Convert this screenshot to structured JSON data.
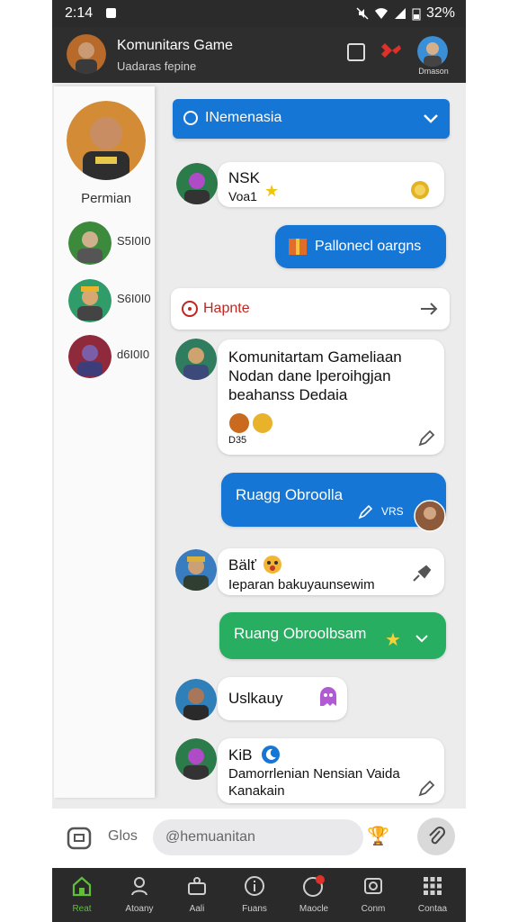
{
  "status": {
    "time": "2:14",
    "battery": "32%"
  },
  "header": {
    "title": "Komunitars Game",
    "subtitle": "Uadaras fepine",
    "user_label": "Dmason"
  },
  "sidebar": {
    "name": "Permian",
    "items": [
      {
        "value": "S5I0I0"
      },
      {
        "value": "S6I0I0"
      },
      {
        "value": "d6I0I0"
      }
    ]
  },
  "select": {
    "label": "INemenasia"
  },
  "messages": {
    "m1": {
      "name": "NSK",
      "sub": "Voa1"
    },
    "m2": {
      "text": "Pallonecl oargns"
    },
    "hap": {
      "label": "Hapnte"
    },
    "m3": {
      "text": "Komunitartam Gameliaan Nodan dane lperoihgjan beahanss Dedaia",
      "meta": "D35"
    },
    "m4": {
      "text": "Ruagg Obroolla",
      "tag": "VRS"
    },
    "m5": {
      "name": "Bälť",
      "text": "Ieparan bakuyaunsewim"
    },
    "m6": {
      "text": "Ruang Obroolbsam"
    },
    "m7": {
      "name": "Uslkauy"
    },
    "m8": {
      "name": "KiB",
      "text": "Damorrlenian Nensian Vaida Kanakain"
    }
  },
  "composer": {
    "label": "Glos",
    "placeholder": "@hemuanitan"
  },
  "nav": [
    {
      "label": "Reat",
      "icon": "home-icon"
    },
    {
      "label": "Atoany",
      "icon": "people-icon"
    },
    {
      "label": "Aali",
      "icon": "contacts-icon"
    },
    {
      "label": "Fuans",
      "icon": "info-icon"
    },
    {
      "label": "Maocle",
      "icon": "notification-icon"
    },
    {
      "label": "Conm",
      "icon": "message-icon"
    },
    {
      "label": "Contaa",
      "icon": "grid-icon"
    }
  ],
  "colors": {
    "blue": "#1676d6",
    "green": "#27ae60",
    "red": "#c0261f",
    "active": "#5fbf3a"
  }
}
